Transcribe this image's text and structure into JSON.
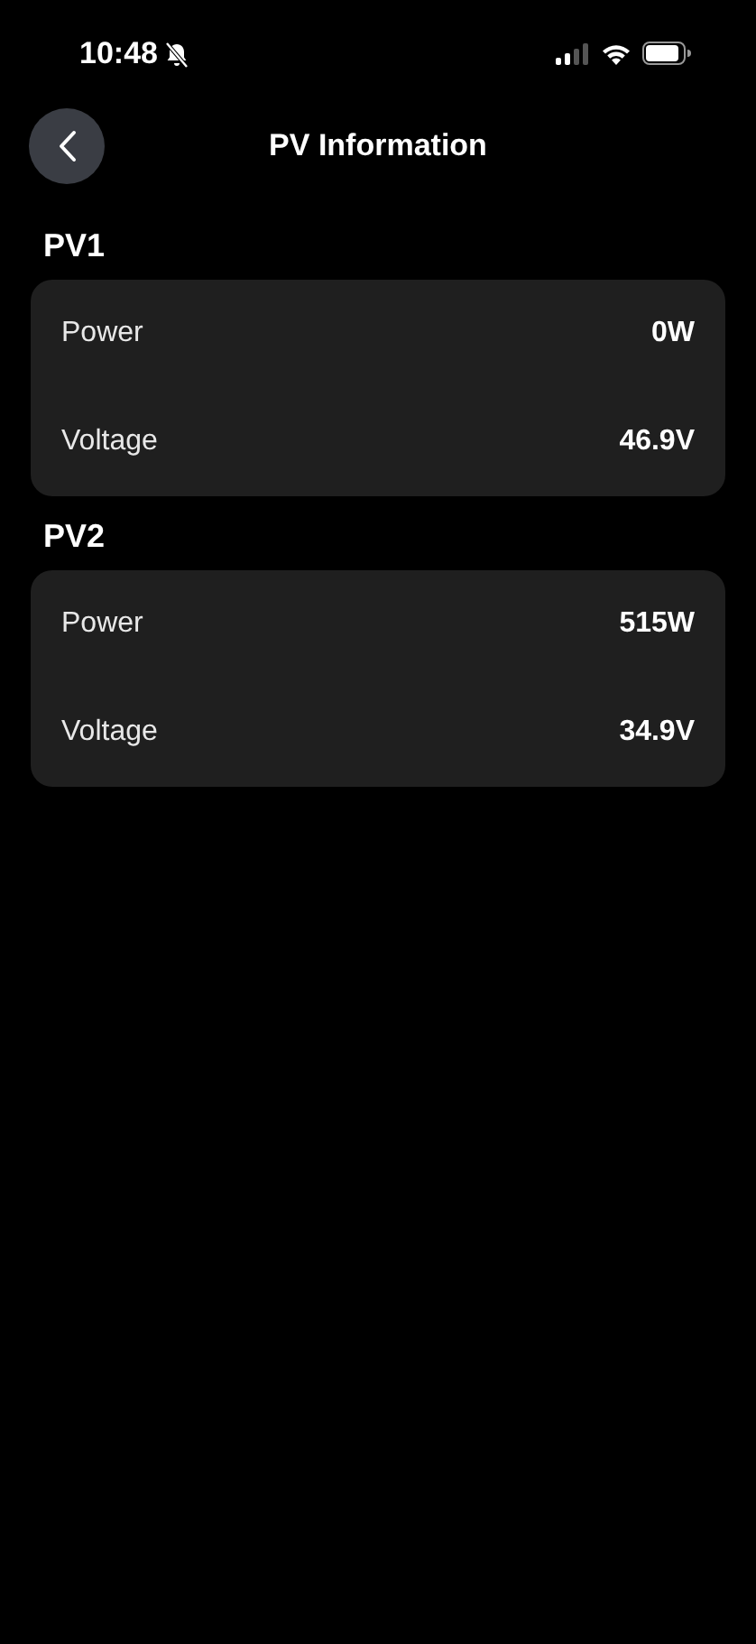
{
  "status_bar": {
    "time": "10:48"
  },
  "header": {
    "title": "PV Information"
  },
  "sections": [
    {
      "title": "PV1",
      "rows": [
        {
          "label": "Power",
          "value": "0W"
        },
        {
          "label": "Voltage",
          "value": "46.9V"
        }
      ]
    },
    {
      "title": "PV2",
      "rows": [
        {
          "label": "Power",
          "value": "515W"
        },
        {
          "label": "Voltage",
          "value": "34.9V"
        }
      ]
    }
  ]
}
